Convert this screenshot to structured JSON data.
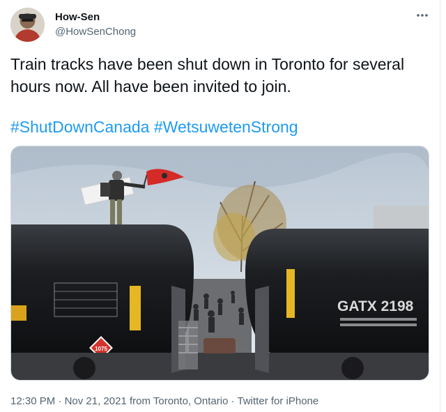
{
  "user": {
    "display_name": "How-Sen",
    "handle": "@HowSenChong"
  },
  "more_icon": "more-horizontal-icon",
  "tweet": {
    "text": "Train tracks have been shut down in Toronto for several hours now. All have been invited to join.",
    "hashtags": [
      "#ShutDownCanada",
      "#WetsuwetenStrong"
    ]
  },
  "media": {
    "tank_car_label": "GATX  2198",
    "placard_number": "1075"
  },
  "footer": {
    "time": "12:30 PM",
    "date": "Nov 21, 2021",
    "location_prefix": "from",
    "location": "Toronto, Ontario",
    "source": "Twitter for iPhone",
    "separator": "·"
  },
  "colors": {
    "link": "#1d9bf0",
    "secondary_text": "#536471",
    "primary_text": "#0f1419"
  }
}
